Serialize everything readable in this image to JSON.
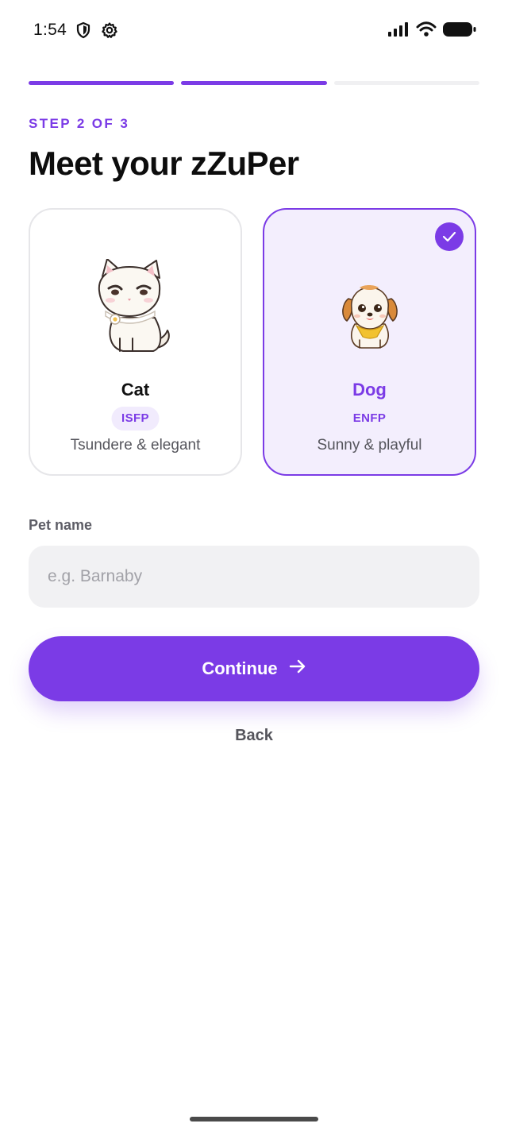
{
  "status_bar": {
    "time": "1:54"
  },
  "progress": {
    "current_step": 2,
    "total_steps": 3
  },
  "step_label": "STEP 2 OF 3",
  "title": "Meet your zZuPer",
  "pets": [
    {
      "name": "Cat",
      "type": "ISFP",
      "description": "Tsundere & elegant",
      "selected": false
    },
    {
      "name": "Dog",
      "type": "ENFP",
      "description": "Sunny & playful",
      "selected": true
    }
  ],
  "pet_name": {
    "label": "Pet name",
    "value": "",
    "placeholder": "e.g. Barnaby"
  },
  "continue_label": "Continue",
  "back_label": "Back",
  "colors": {
    "accent": "#7b3be6",
    "selected_card_bg": "#f3eefd",
    "input_bg": "#f1f1f3"
  }
}
